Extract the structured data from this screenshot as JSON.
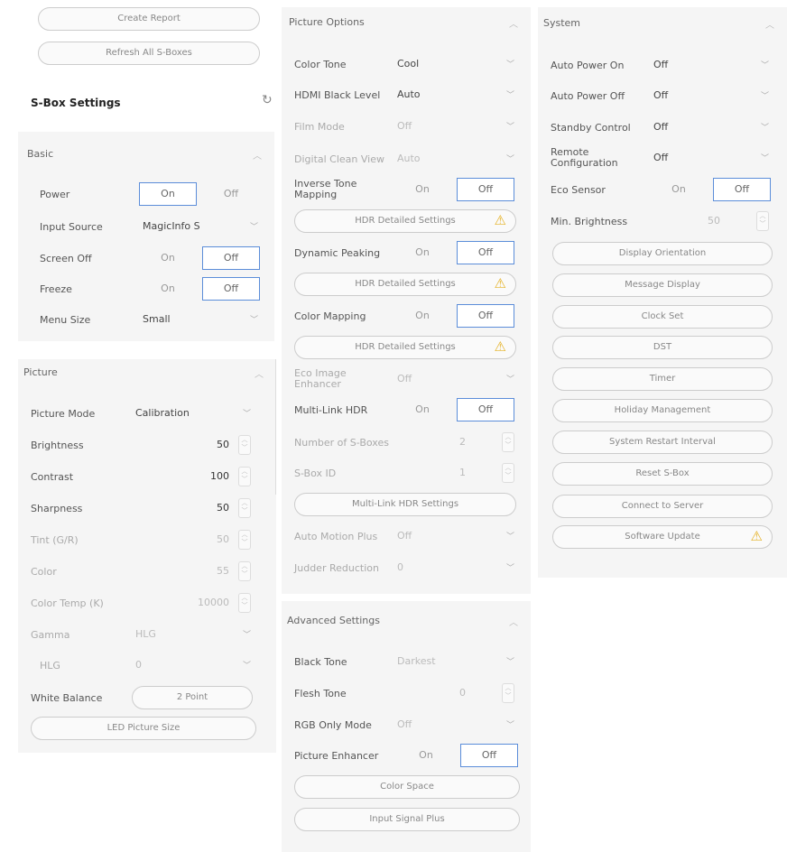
{
  "top_actions": {
    "create_report": "Create Report",
    "refresh_all": "Refresh All S-Boxes"
  },
  "sbox_settings": {
    "title": "S-Box Settings"
  },
  "basic": {
    "title": "Basic",
    "power": {
      "label": "Power",
      "on": "On",
      "off": "Off"
    },
    "input_source": {
      "label": "Input Source",
      "value": "MagicInfo S"
    },
    "screen_off": {
      "label": "Screen Off",
      "on": "On",
      "off": "Off"
    },
    "freeze": {
      "label": "Freeze",
      "on": "On",
      "off": "Off"
    },
    "menu_size": {
      "label": "Menu Size",
      "value": "Small"
    }
  },
  "picture": {
    "title": "Picture",
    "picture_mode": {
      "label": "Picture Mode",
      "value": "Calibration"
    },
    "brightness": {
      "label": "Brightness",
      "value": "50"
    },
    "contrast": {
      "label": "Contrast",
      "value": "100"
    },
    "sharpness": {
      "label": "Sharpness",
      "value": "50"
    },
    "tint": {
      "label": "Tint (G/R)",
      "value": "50"
    },
    "color": {
      "label": "Color",
      "value": "55"
    },
    "color_temp": {
      "label": "Color Temp (K)",
      "value": "10000"
    },
    "gamma": {
      "label": "Gamma",
      "value": "HLG"
    },
    "hlg": {
      "label": "HLG",
      "value": "0"
    },
    "white_balance": {
      "label": "White Balance",
      "value": "2 Point"
    },
    "led_picture_size": "LED Picture Size"
  },
  "picture_options": {
    "title": "Picture Options",
    "color_tone": {
      "label": "Color Tone",
      "value": "Cool"
    },
    "hdmi_black_level": {
      "label": "HDMI Black Level",
      "value": "Auto"
    },
    "film_mode": {
      "label": "Film Mode",
      "value": "Off"
    },
    "digital_clean_view": {
      "label": "Digital Clean View",
      "value": "Auto"
    },
    "inverse_tone_mapping": {
      "label": "Inverse Tone Mapping",
      "on": "On",
      "off": "Off"
    },
    "hdr_detailed_1": "HDR Detailed Settings",
    "dynamic_peaking": {
      "label": "Dynamic Peaking",
      "on": "On",
      "off": "Off"
    },
    "hdr_detailed_2": "HDR Detailed Settings",
    "color_mapping": {
      "label": "Color Mapping",
      "on": "On",
      "off": "Off"
    },
    "hdr_detailed_3": "HDR Detailed Settings",
    "eco_image_enhancer": {
      "label": "Eco Image Enhancer",
      "value": "Off"
    },
    "multi_link_hdr": {
      "label": "Multi-Link HDR",
      "on": "On",
      "off": "Off"
    },
    "number_of_sboxes": {
      "label": "Number of S-Boxes",
      "value": "2"
    },
    "sbox_id": {
      "label": "S-Box ID",
      "value": "1"
    },
    "multi_link_hdr_settings": "Multi-Link HDR Settings",
    "auto_motion_plus": {
      "label": "Auto Motion Plus",
      "value": "Off"
    },
    "judder_reduction": {
      "label": "Judder Reduction",
      "value": "0"
    }
  },
  "advanced": {
    "title": "Advanced Settings",
    "black_tone": {
      "label": "Black Tone",
      "value": "Darkest"
    },
    "flesh_tone": {
      "label": "Flesh Tone",
      "value": "0"
    },
    "rgb_only_mode": {
      "label": "RGB Only Mode",
      "value": "Off"
    },
    "picture_enhancer": {
      "label": "Picture Enhancer",
      "on": "On",
      "off": "Off"
    },
    "color_space": "Color Space",
    "input_signal_plus": "Input Signal Plus"
  },
  "system": {
    "title": "System",
    "auto_power_on": {
      "label": "Auto Power On",
      "value": "Off"
    },
    "auto_power_off": {
      "label": "Auto Power Off",
      "value": "Off"
    },
    "standby_control": {
      "label": "Standby Control",
      "value": "Off"
    },
    "remote_configuration": {
      "label": "Remote Configuration",
      "value": "Off"
    },
    "eco_sensor": {
      "label": "Eco Sensor",
      "on": "On",
      "off": "Off"
    },
    "min_brightness": {
      "label": "Min. Brightness",
      "value": "50"
    },
    "buttons": [
      "Display Orientation",
      "Message Display",
      "Clock Set",
      "DST",
      "Timer",
      "Holiday Management",
      "System Restart Interval",
      "Reset S-Box",
      "Connect to Server",
      "Software Update"
    ]
  },
  "icons": {
    "chevron_up": "chevron-up-icon",
    "chevron_down": "chevron-down-icon",
    "warning": "warning-icon",
    "refresh": "refresh-icon",
    "spinner": "spinner-icon"
  },
  "colors": {
    "toggle_selected_border": "#5b8dd9",
    "warning": "#e5b226",
    "panel_bg": "#f5f5f5"
  }
}
